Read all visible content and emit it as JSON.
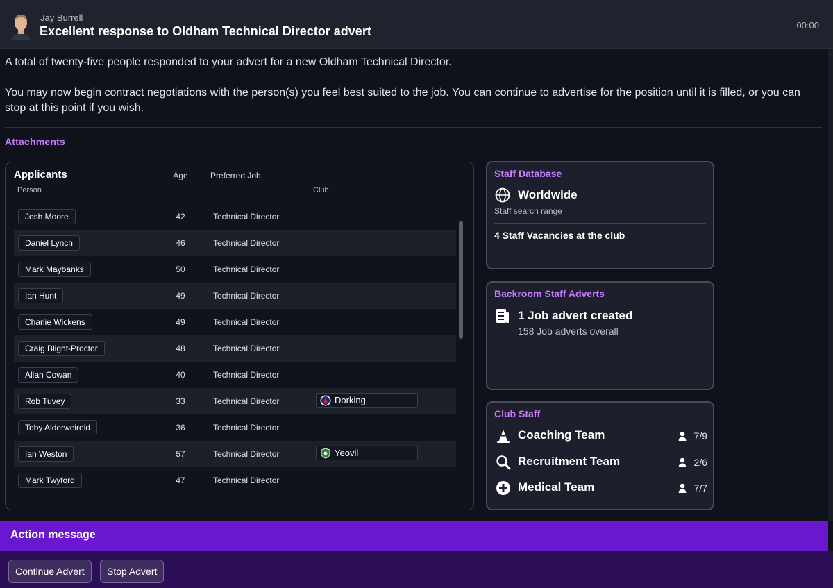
{
  "message": {
    "sender": "Jay Burrell",
    "subject": "Excellent response to Oldham Technical Director advert",
    "time": "00:00",
    "body": [
      "A total of twenty-five people responded to your advert for a new Oldham Technical Director.",
      "You may now begin contract negotiations with the person(s) you feel best suited to the job. You can continue to advertise for the position until it is filled, or you can stop at this point if you wish."
    ],
    "attachments_label": "Attachments"
  },
  "applicants": {
    "title": "Applicants",
    "columns": {
      "person": "Person",
      "age": "Age",
      "job": "Preferred Job",
      "club": "Club"
    },
    "rows": [
      {
        "name": "Josh Moore",
        "age": "42",
        "job": "Technical Director",
        "club": ""
      },
      {
        "name": "Daniel Lynch",
        "age": "46",
        "job": "Technical Director",
        "club": ""
      },
      {
        "name": "Mark Maybanks",
        "age": "50",
        "job": "Technical Director",
        "club": ""
      },
      {
        "name": "Ian Hunt",
        "age": "49",
        "job": "Technical Director",
        "club": ""
      },
      {
        "name": "Charlie Wickens",
        "age": "49",
        "job": "Technical Director",
        "club": ""
      },
      {
        "name": "Craig Blight-Proctor",
        "age": "48",
        "job": "Technical Director",
        "club": ""
      },
      {
        "name": "Allan Cowan",
        "age": "40",
        "job": "Technical Director",
        "club": ""
      },
      {
        "name": "Rob Tuvey",
        "age": "33",
        "job": "Technical Director",
        "club": "Dorking"
      },
      {
        "name": "Toby Alderweireld",
        "age": "36",
        "job": "Technical Director",
        "club": ""
      },
      {
        "name": "Ian Weston",
        "age": "57",
        "job": "Technical Director",
        "club": "Yeovil"
      },
      {
        "name": "Mark Twyford",
        "age": "47",
        "job": "Technical Director",
        "club": ""
      }
    ]
  },
  "staff_database": {
    "title": "Staff Database",
    "range": "Worldwide",
    "range_label": "Staff search range",
    "vacancies": "4 Staff Vacancies at the club",
    "icon": "globe-icon"
  },
  "backroom_adverts": {
    "title": "Backroom Staff Adverts",
    "created": "1 Job advert created",
    "overall": "158 Job adverts overall",
    "icon": "document-icon"
  },
  "club_staff": {
    "title": "Club Staff",
    "teams": [
      {
        "label": "Coaching Team",
        "count": "7/9",
        "icon": "cone-icon"
      },
      {
        "label": "Recruitment Team",
        "count": "2/6",
        "icon": "magnifier-icon"
      },
      {
        "label": "Medical Team",
        "count": "7/7",
        "icon": "medical-plus-icon"
      }
    ]
  },
  "action": {
    "title": "Action message",
    "continue_label": "Continue Advert",
    "stop_label": "Stop Advert"
  },
  "colors": {
    "accent": "#c77dff",
    "action_bar": "#6a17d0",
    "footer": "#2d0f58",
    "background": "#0f111b"
  }
}
